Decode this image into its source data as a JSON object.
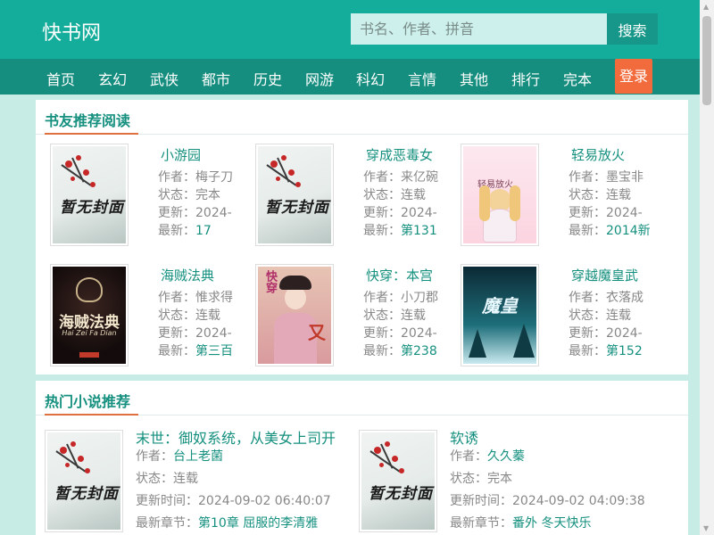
{
  "site": {
    "logo": "快书网"
  },
  "search": {
    "placeholder": "书名、作者、拼音",
    "button": "搜索"
  },
  "nav": {
    "items": [
      "首页",
      "玄幻",
      "武侠",
      "都市",
      "历史",
      "网游",
      "科幻",
      "言情",
      "其他",
      "排行",
      "完本"
    ],
    "login": "登录"
  },
  "recommend": {
    "title": "书友推荐阅读",
    "labels": {
      "author": "作者：",
      "status": "状态：",
      "update": "更新：",
      "latest": "最新："
    },
    "books": [
      {
        "name": "小游园",
        "author": "梅子刀",
        "status": "完本",
        "update": "2024-",
        "latest": "17"
      },
      {
        "name": "穿成恶毒女",
        "author": "来亿碗",
        "status": "连载",
        "update": "2024-",
        "latest": "第131"
      },
      {
        "name": "轻易放火",
        "author": "墨宝非",
        "status": "连载",
        "update": "2024-",
        "latest": "2014新"
      },
      {
        "name": "海贼法典",
        "author": "惟求得",
        "status": "连载",
        "update": "2024-",
        "latest": "第三百"
      },
      {
        "name": "快穿：本宫",
        "author": "小刀郡",
        "status": "连载",
        "update": "2024-",
        "latest": "第238"
      },
      {
        "name": "穿越魔皇武",
        "author": "衣落成",
        "status": "连载",
        "update": "2024-",
        "latest": "第152"
      }
    ]
  },
  "hot": {
    "title": "热门小说推荐",
    "labels": {
      "author": "作者：",
      "status": "状态：",
      "update": "更新时间：",
      "latest": "最新章节："
    },
    "books": [
      {
        "name": "末世：御奴系统，从美女上司开",
        "author": "台上老菌",
        "status": "连载",
        "update": "2024-09-02 06:40:07",
        "latest": "第10章 屈服的李清雅"
      },
      {
        "name": "软诱",
        "author": "久久蓁",
        "status": "完本",
        "update": "2024-09-02 04:09:38",
        "latest": "番外 冬天快乐"
      }
    ]
  },
  "covers": {
    "nocover": "暂无封面",
    "qing": "轻易放火",
    "hai_title": "海贼法典",
    "hai_sub": "Hai Zei Fa Dian",
    "kuai": "快穿",
    "chuan": "魔皇"
  }
}
